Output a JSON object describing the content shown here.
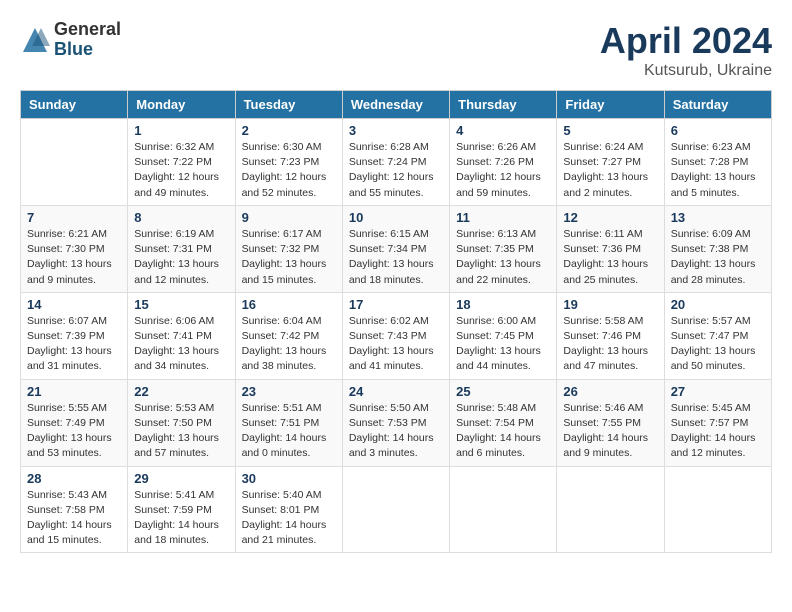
{
  "header": {
    "logo_general": "General",
    "logo_blue": "Blue",
    "month": "April 2024",
    "location": "Kutsurub, Ukraine"
  },
  "weekdays": [
    "Sunday",
    "Monday",
    "Tuesday",
    "Wednesday",
    "Thursday",
    "Friday",
    "Saturday"
  ],
  "weeks": [
    [
      {
        "day": "",
        "info": ""
      },
      {
        "day": "1",
        "info": "Sunrise: 6:32 AM\nSunset: 7:22 PM\nDaylight: 12 hours\nand 49 minutes."
      },
      {
        "day": "2",
        "info": "Sunrise: 6:30 AM\nSunset: 7:23 PM\nDaylight: 12 hours\nand 52 minutes."
      },
      {
        "day": "3",
        "info": "Sunrise: 6:28 AM\nSunset: 7:24 PM\nDaylight: 12 hours\nand 55 minutes."
      },
      {
        "day": "4",
        "info": "Sunrise: 6:26 AM\nSunset: 7:26 PM\nDaylight: 12 hours\nand 59 minutes."
      },
      {
        "day": "5",
        "info": "Sunrise: 6:24 AM\nSunset: 7:27 PM\nDaylight: 13 hours\nand 2 minutes."
      },
      {
        "day": "6",
        "info": "Sunrise: 6:23 AM\nSunset: 7:28 PM\nDaylight: 13 hours\nand 5 minutes."
      }
    ],
    [
      {
        "day": "7",
        "info": "Sunrise: 6:21 AM\nSunset: 7:30 PM\nDaylight: 13 hours\nand 9 minutes."
      },
      {
        "day": "8",
        "info": "Sunrise: 6:19 AM\nSunset: 7:31 PM\nDaylight: 13 hours\nand 12 minutes."
      },
      {
        "day": "9",
        "info": "Sunrise: 6:17 AM\nSunset: 7:32 PM\nDaylight: 13 hours\nand 15 minutes."
      },
      {
        "day": "10",
        "info": "Sunrise: 6:15 AM\nSunset: 7:34 PM\nDaylight: 13 hours\nand 18 minutes."
      },
      {
        "day": "11",
        "info": "Sunrise: 6:13 AM\nSunset: 7:35 PM\nDaylight: 13 hours\nand 22 minutes."
      },
      {
        "day": "12",
        "info": "Sunrise: 6:11 AM\nSunset: 7:36 PM\nDaylight: 13 hours\nand 25 minutes."
      },
      {
        "day": "13",
        "info": "Sunrise: 6:09 AM\nSunset: 7:38 PM\nDaylight: 13 hours\nand 28 minutes."
      }
    ],
    [
      {
        "day": "14",
        "info": "Sunrise: 6:07 AM\nSunset: 7:39 PM\nDaylight: 13 hours\nand 31 minutes."
      },
      {
        "day": "15",
        "info": "Sunrise: 6:06 AM\nSunset: 7:41 PM\nDaylight: 13 hours\nand 34 minutes."
      },
      {
        "day": "16",
        "info": "Sunrise: 6:04 AM\nSunset: 7:42 PM\nDaylight: 13 hours\nand 38 minutes."
      },
      {
        "day": "17",
        "info": "Sunrise: 6:02 AM\nSunset: 7:43 PM\nDaylight: 13 hours\nand 41 minutes."
      },
      {
        "day": "18",
        "info": "Sunrise: 6:00 AM\nSunset: 7:45 PM\nDaylight: 13 hours\nand 44 minutes."
      },
      {
        "day": "19",
        "info": "Sunrise: 5:58 AM\nSunset: 7:46 PM\nDaylight: 13 hours\nand 47 minutes."
      },
      {
        "day": "20",
        "info": "Sunrise: 5:57 AM\nSunset: 7:47 PM\nDaylight: 13 hours\nand 50 minutes."
      }
    ],
    [
      {
        "day": "21",
        "info": "Sunrise: 5:55 AM\nSunset: 7:49 PM\nDaylight: 13 hours\nand 53 minutes."
      },
      {
        "day": "22",
        "info": "Sunrise: 5:53 AM\nSunset: 7:50 PM\nDaylight: 13 hours\nand 57 minutes."
      },
      {
        "day": "23",
        "info": "Sunrise: 5:51 AM\nSunset: 7:51 PM\nDaylight: 14 hours\nand 0 minutes."
      },
      {
        "day": "24",
        "info": "Sunrise: 5:50 AM\nSunset: 7:53 PM\nDaylight: 14 hours\nand 3 minutes."
      },
      {
        "day": "25",
        "info": "Sunrise: 5:48 AM\nSunset: 7:54 PM\nDaylight: 14 hours\nand 6 minutes."
      },
      {
        "day": "26",
        "info": "Sunrise: 5:46 AM\nSunset: 7:55 PM\nDaylight: 14 hours\nand 9 minutes."
      },
      {
        "day": "27",
        "info": "Sunrise: 5:45 AM\nSunset: 7:57 PM\nDaylight: 14 hours\nand 12 minutes."
      }
    ],
    [
      {
        "day": "28",
        "info": "Sunrise: 5:43 AM\nSunset: 7:58 PM\nDaylight: 14 hours\nand 15 minutes."
      },
      {
        "day": "29",
        "info": "Sunrise: 5:41 AM\nSunset: 7:59 PM\nDaylight: 14 hours\nand 18 minutes."
      },
      {
        "day": "30",
        "info": "Sunrise: 5:40 AM\nSunset: 8:01 PM\nDaylight: 14 hours\nand 21 minutes."
      },
      {
        "day": "",
        "info": ""
      },
      {
        "day": "",
        "info": ""
      },
      {
        "day": "",
        "info": ""
      },
      {
        "day": "",
        "info": ""
      }
    ]
  ]
}
